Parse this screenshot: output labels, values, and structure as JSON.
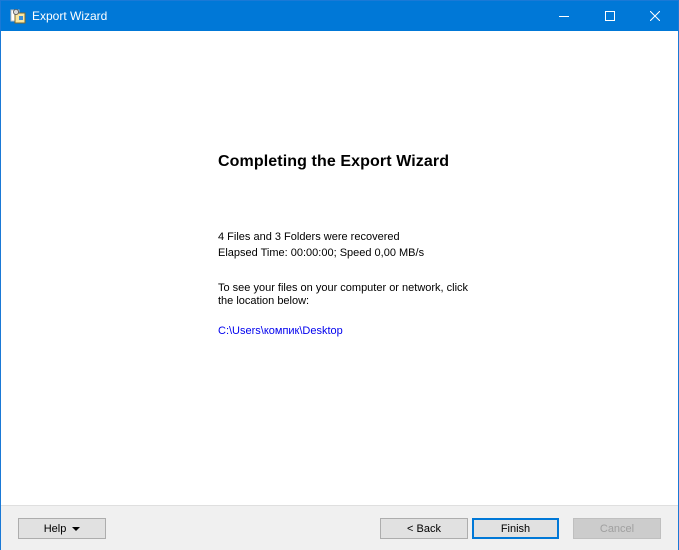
{
  "window": {
    "title": "Export Wizard",
    "app_icon": "export-wizard-app-icon",
    "controls": {
      "minimize_icon": "minimize-icon",
      "maximize_icon": "maximize-icon",
      "close_icon": "close-icon"
    }
  },
  "content": {
    "heading": "Completing the Export Wizard",
    "recovered_summary": "4 Files and 3 Folders were recovered",
    "elapsed_line": "Elapsed Time: 00:00:00; Speed 0,00 MB/s",
    "instructions_line1": "To see your files on your computer or network, click",
    "instructions_line2": "the location below:",
    "location_path": "C:\\Users\\компик\\Desktop"
  },
  "footer": {
    "help_label": "Help",
    "back_label": "< Back",
    "finish_label": "Finish",
    "cancel_label": "Cancel"
  },
  "colors": {
    "titlebar": "#0078d7",
    "link": "#0000ee",
    "footer_bg": "#f0f0f0"
  }
}
